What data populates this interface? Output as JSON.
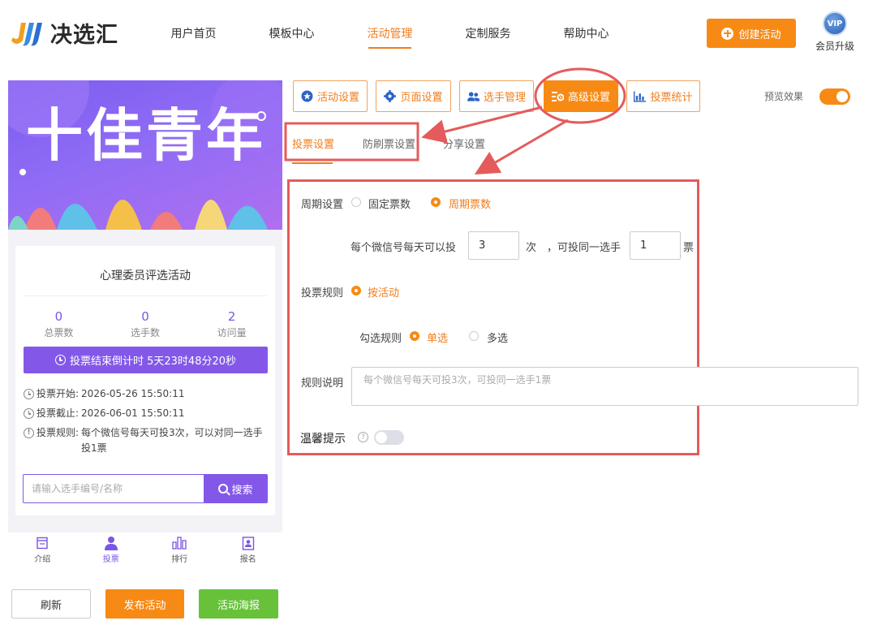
{
  "app": {
    "logo_text": "决选汇",
    "nav": [
      "用户首页",
      "模板中心",
      "活动管理",
      "定制服务",
      "帮助中心"
    ],
    "create_label": "创建活动",
    "vip_badge": "VIP",
    "vip_label": "会员升级"
  },
  "preview": {
    "banner_title": "十佳青年",
    "activity_title": "心理委员评选活动",
    "stats": [
      {
        "value": "0",
        "label": "总票数"
      },
      {
        "value": "0",
        "label": "选手数"
      },
      {
        "value": "2",
        "label": "访问量"
      }
    ],
    "countdown": "投票结束倒计时 5天23时48分20秒",
    "start_label": "投票开始:",
    "start_value": "2026-05-26 15:50:11",
    "end_label": "投票截止:",
    "end_value": "2026-06-01 15:50:11",
    "rule_label": "投票规则:",
    "rule_value": "每个微信号每天可投3次，可以对同一选手投1票",
    "search_placeholder": "请输入选手编号/名称",
    "search_button": "搜索",
    "tabbar": [
      "介绍",
      "投票",
      "排行",
      "报名"
    ]
  },
  "bottom_buttons": {
    "refresh": "刷新",
    "publish": "发布活动",
    "poster": "活动海报"
  },
  "toolbar": {
    "buttons": [
      "活动设置",
      "页面设置",
      "选手管理",
      "高级设置",
      "投票统计"
    ],
    "preview_label": "预览效果",
    "preview_on": true
  },
  "subtabs": [
    "投票设置",
    "防刷票设置",
    "分享设置"
  ],
  "form": {
    "period_label": "周期设置",
    "period_options": [
      "固定票数",
      "周期票数"
    ],
    "period_selected": "周期票数",
    "per_day_prefix": "每个微信号每天可以投",
    "per_day_value": "3",
    "per_day_unit": "次",
    "same_prefix": "，可投同一选手",
    "same_value": "1",
    "same_unit": "票",
    "rule_label": "投票规则",
    "rule_option": "按活动",
    "check_label": "勾选规则",
    "check_options": [
      "单选",
      "多选"
    ],
    "check_selected": "单选",
    "desc_label": "规则说明",
    "desc_placeholder": "每个微信号每天可投3次，可投同一选手1票",
    "tip_label": "温馨提示",
    "tip_enabled": false
  },
  "colors": {
    "accent": "#f78a15",
    "purple": "#8358e8",
    "green": "#67c23a",
    "annotation": "#e55b5b"
  }
}
